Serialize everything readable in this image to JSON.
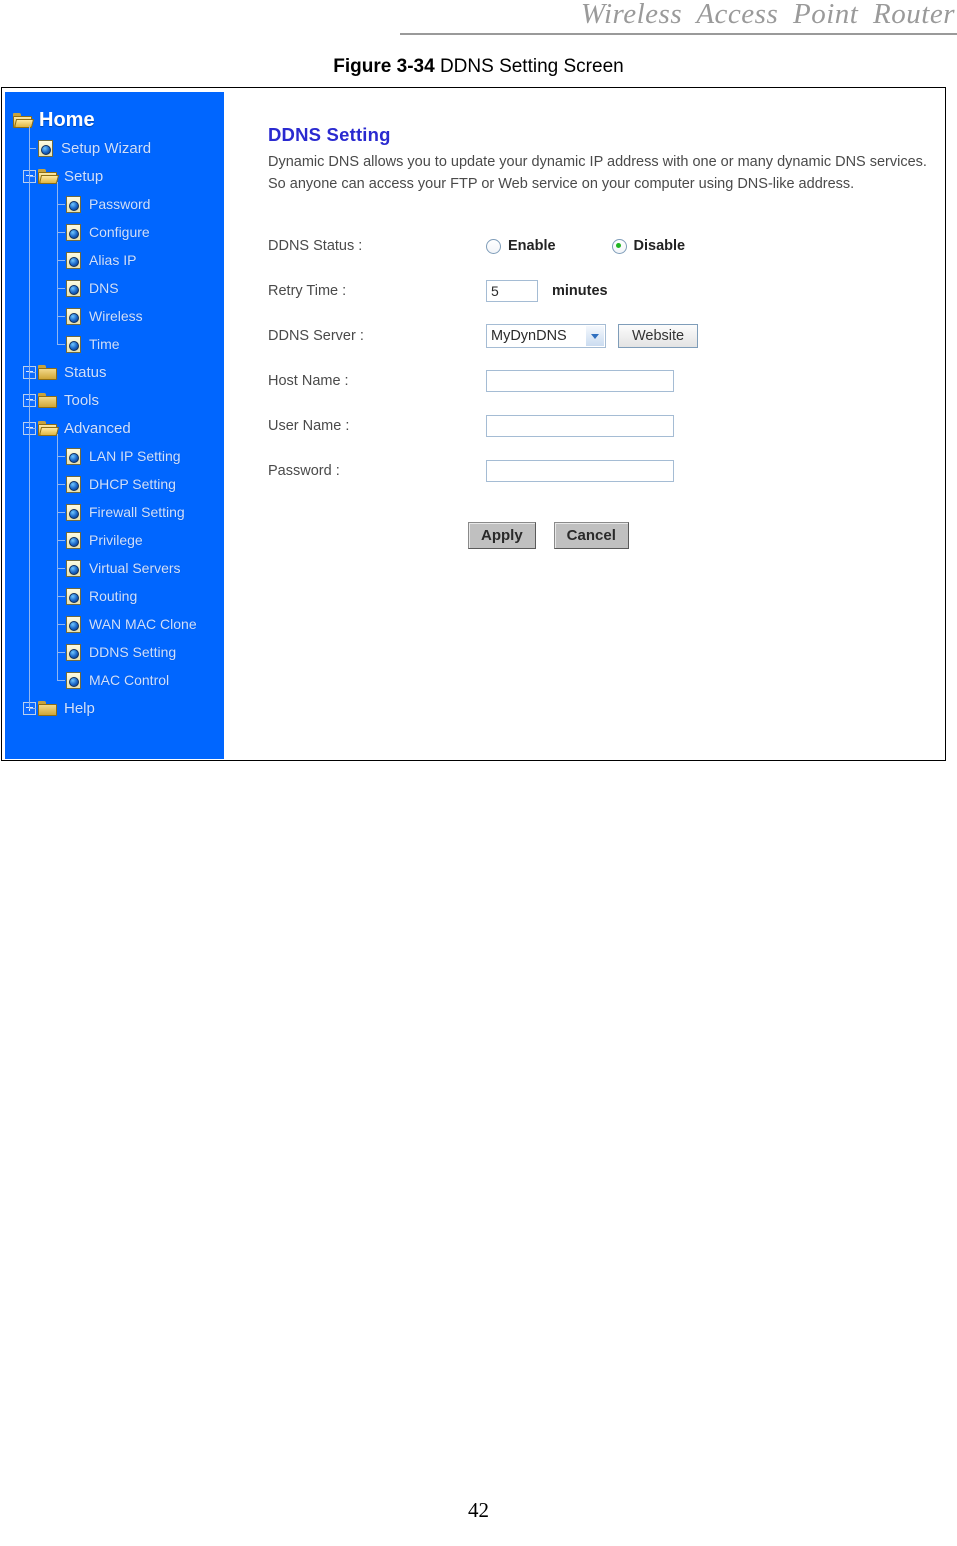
{
  "page": {
    "running_header": "Wireless  Access  Point  Router",
    "number": "42"
  },
  "figure": {
    "number": "Figure 3-34",
    "caption": "DDNS Setting Screen"
  },
  "sidebar": {
    "items": [
      {
        "label": "Home",
        "level": "home",
        "icon": "folder-open-icon",
        "expander": "none"
      },
      {
        "label": "Setup Wizard",
        "level": "1",
        "icon": "page-icon",
        "expander": "none"
      },
      {
        "label": "Setup",
        "level": "1",
        "icon": "folder-open-icon",
        "expander": "minus"
      },
      {
        "label": "Password",
        "level": "2",
        "icon": "page-icon",
        "expander": "none"
      },
      {
        "label": "Configure",
        "level": "2",
        "icon": "page-icon",
        "expander": "none"
      },
      {
        "label": "Alias IP",
        "level": "2",
        "icon": "page-icon",
        "expander": "none"
      },
      {
        "label": "DNS",
        "level": "2",
        "icon": "page-icon",
        "expander": "none"
      },
      {
        "label": "Wireless",
        "level": "2",
        "icon": "page-icon",
        "expander": "none"
      },
      {
        "label": "Time",
        "level": "2",
        "icon": "page-icon",
        "expander": "none"
      },
      {
        "label": "Status",
        "level": "1",
        "icon": "folder-icon",
        "expander": "plus"
      },
      {
        "label": "Tools",
        "level": "1",
        "icon": "folder-icon",
        "expander": "plus"
      },
      {
        "label": "Advanced",
        "level": "1",
        "icon": "folder-open-icon",
        "expander": "minus"
      },
      {
        "label": "LAN IP Setting",
        "level": "2",
        "icon": "page-icon",
        "expander": "none"
      },
      {
        "label": "DHCP Setting",
        "level": "2",
        "icon": "page-icon",
        "expander": "none"
      },
      {
        "label": "Firewall Setting",
        "level": "2",
        "icon": "page-icon",
        "expander": "none"
      },
      {
        "label": "Privilege",
        "level": "2",
        "icon": "page-icon",
        "expander": "none"
      },
      {
        "label": "Virtual Servers",
        "level": "2",
        "icon": "page-icon",
        "expander": "none"
      },
      {
        "label": "Routing",
        "level": "2",
        "icon": "page-icon",
        "expander": "none"
      },
      {
        "label": "WAN MAC Clone",
        "level": "2",
        "icon": "page-icon",
        "expander": "none"
      },
      {
        "label": "DDNS Setting",
        "level": "2",
        "icon": "page-icon",
        "expander": "none"
      },
      {
        "label": "MAC Control",
        "level": "2",
        "icon": "page-icon",
        "expander": "none"
      },
      {
        "label": "Help",
        "level": "1",
        "icon": "folder-icon",
        "expander": "plus"
      }
    ],
    "background_color": "#0066ff",
    "label_color": "#cfe0ff"
  },
  "main": {
    "title": "DDNS Setting",
    "title_color": "#2a2ad0",
    "description": "Dynamic DNS allows you to update your dynamic IP address with one or many dynamic DNS services. So anyone can access your FTP or Web service on your computer using DNS-like address.",
    "fields": {
      "ddns_status": {
        "label": "DDNS Status :",
        "options": [
          {
            "label": "Enable",
            "selected": false
          },
          {
            "label": "Disable",
            "selected": true
          }
        ],
        "selected_color": "#21b521"
      },
      "retry_time": {
        "label": "Retry Time :",
        "value": "5",
        "placeholder": "",
        "unit": "minutes"
      },
      "ddns_server": {
        "label": "DDNS Server :",
        "selected": "MyDynDNS",
        "options": [
          "MyDynDNS"
        ],
        "website_button": "Website"
      },
      "host_name": {
        "label": "Host Name :",
        "value": "",
        "placeholder": ""
      },
      "user_name": {
        "label": "User Name :",
        "value": "",
        "placeholder": ""
      },
      "password": {
        "label": "Password :",
        "value": "",
        "placeholder": ""
      }
    },
    "buttons": {
      "apply": "Apply",
      "cancel": "Cancel"
    }
  }
}
